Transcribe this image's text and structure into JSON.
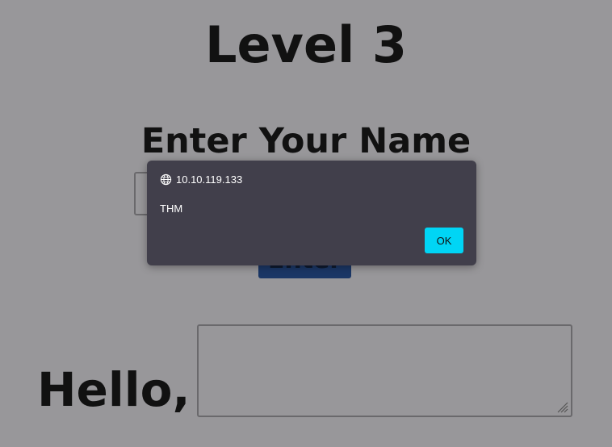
{
  "page": {
    "title": "Level 3",
    "name_heading": "Enter Your Name",
    "enter_button_label": "Enter",
    "greeting": "Hello,"
  },
  "dialog": {
    "origin": "10.10.119.133",
    "message": "THM",
    "ok_label": "OK",
    "origin_icon": "globe-icon"
  },
  "colors": {
    "page_background": "#98979a",
    "dialog_background": "#413f4b",
    "ok_button": "#00d5f5",
    "enter_button": "#1b3766"
  }
}
